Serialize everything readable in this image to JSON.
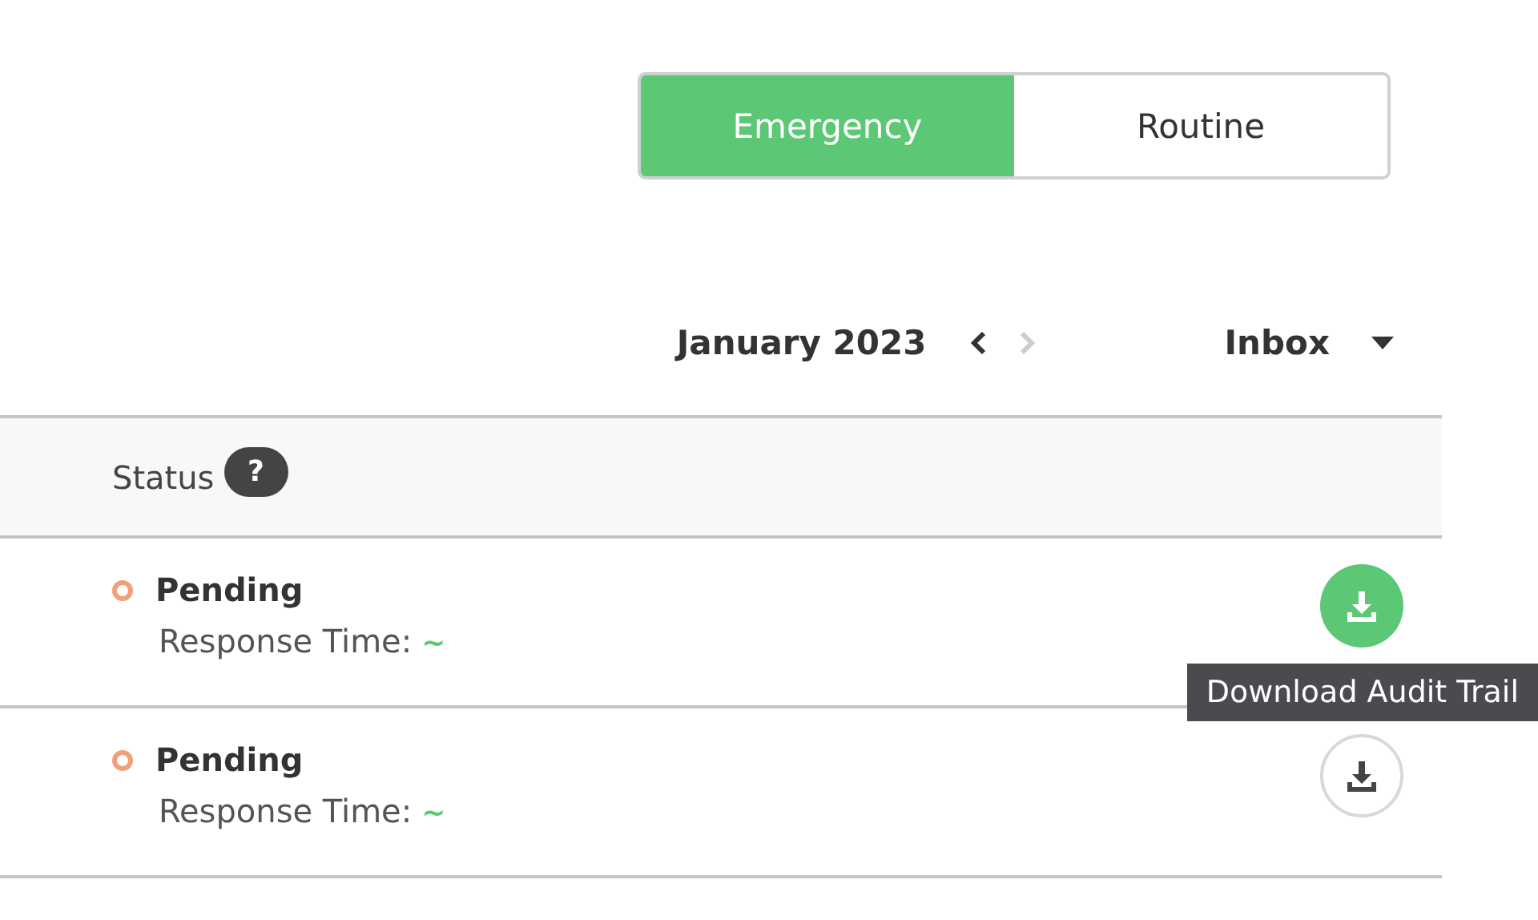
{
  "toggle": [
    {
      "label": "Emergency",
      "selected": true
    },
    {
      "label": "Routine",
      "selected": false
    }
  ],
  "period": {
    "label": "January 2023",
    "prev_disabled": false,
    "next_disabled": true
  },
  "folder": {
    "label": "Inbox"
  },
  "table": {
    "columns": [
      {
        "label": "Status",
        "help": "?"
      }
    ],
    "rows": [
      {
        "status": "Pending",
        "color": "#f0a07a",
        "response_label": "Response Time:",
        "response_value": "~",
        "download_highlighted": true,
        "tooltip": "Download Audit Trail"
      },
      {
        "status": "Pending",
        "color": "#f0a07a",
        "response_label": "Response Time:",
        "response_value": "~",
        "download_highlighted": false
      }
    ]
  }
}
